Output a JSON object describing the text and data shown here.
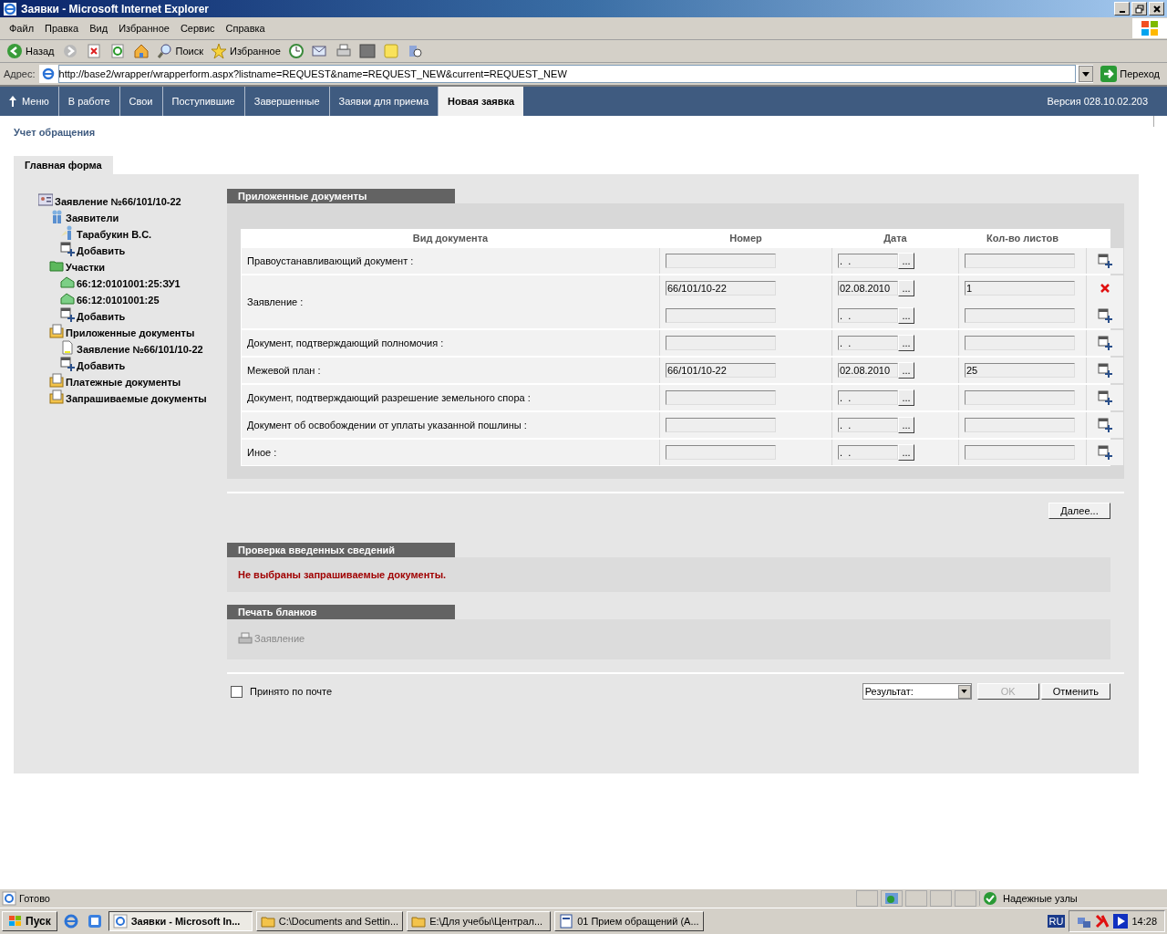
{
  "window": {
    "title": "Заявки - Microsoft Internet Explorer"
  },
  "menu": [
    "Файл",
    "Правка",
    "Вид",
    "Избранное",
    "Сервис",
    "Справка"
  ],
  "toolbar": [
    {
      "kind": "back",
      "label": "Назад"
    },
    {
      "kind": "forward"
    },
    {
      "kind": "stop"
    },
    {
      "kind": "refresh"
    },
    {
      "kind": "home"
    },
    {
      "kind": "search",
      "label": "Поиск"
    },
    {
      "kind": "favorites",
      "label": "Избранное"
    },
    {
      "kind": "history"
    },
    {
      "kind": "mail"
    },
    {
      "kind": "print"
    },
    {
      "kind": "edit"
    },
    {
      "kind": "note"
    },
    {
      "kind": "research"
    }
  ],
  "address": {
    "label": "Адрес:",
    "value": "http://base2/wrapper/wrapperform.aspx?listname=REQUEST&name=REQUEST_NEW&current=REQUEST_NEW",
    "go": "Переход"
  },
  "nav": {
    "tabs": [
      {
        "label": "Меню",
        "selected": false
      },
      {
        "label": "В работе",
        "selected": false
      },
      {
        "label": "Свои",
        "selected": false
      },
      {
        "label": "Поступившие",
        "selected": false
      },
      {
        "label": "Завершенные",
        "selected": false
      },
      {
        "label": "Заявки для приема",
        "selected": false
      },
      {
        "label": "Новая заявка",
        "selected": true
      }
    ],
    "version": "Версия 028.10.02.203"
  },
  "page_title": "Учет обращения",
  "form_tab": "Главная форма",
  "tree": [
    {
      "label": "Заявление №66/101/10-22",
      "kind": "card",
      "children": [
        {
          "label": "Заявители",
          "kind": "people",
          "children": [
            {
              "label": "Тарабукин В.С.",
              "kind": "person"
            },
            {
              "label": "Добавить",
              "kind": "add"
            }
          ]
        },
        {
          "label": "Участки",
          "kind": "folder",
          "children": [
            {
              "label": "66:12:0101001:25:ЗУ1",
              "kind": "parcel"
            },
            {
              "label": "66:12:0101001:25",
              "kind": "parcel"
            },
            {
              "label": "Добавить",
              "kind": "add"
            }
          ]
        },
        {
          "label": "Приложенные документы",
          "kind": "docs",
          "children": [
            {
              "label": "Заявление №66/101/10-22",
              "kind": "doc"
            },
            {
              "label": "Добавить",
              "kind": "add"
            }
          ]
        },
        {
          "label": "Платежные документы",
          "kind": "docs"
        },
        {
          "label": "Запрашиваемые документы",
          "kind": "docs"
        }
      ]
    }
  ],
  "documents": {
    "title": "Приложенные документы",
    "columns": [
      "Вид документа",
      "Номер",
      "Дата",
      "Кол-во листов"
    ],
    "rows": [
      {
        "label": "Правоустанавливающий документ :",
        "entries": [
          {
            "date": ".  .",
            "kind": "add"
          }
        ]
      },
      {
        "label": "Заявление :",
        "entries": [
          {
            "number": "66/101/10-22",
            "date": "02.08.2010",
            "sheets": "1",
            "kind": "delete"
          },
          {
            "date": ".  .",
            "kind": "add"
          }
        ]
      },
      {
        "label": "Документ, подтверждающий полномочия :",
        "entries": [
          {
            "date": ".  .",
            "kind": "add"
          }
        ]
      },
      {
        "label": "Межевой план :",
        "entries": [
          {
            "number": "66/101/10-22",
            "date": "02.08.2010",
            "sheets": "25",
            "kind": "add"
          }
        ]
      },
      {
        "label": "Документ, подтверждающий разрешение земельного спора :",
        "entries": [
          {
            "date": ".  .",
            "kind": "add"
          }
        ]
      },
      {
        "label": "Документ об освобождении от уплаты указанной пошлины :",
        "entries": [
          {
            "date": ".  .",
            "kind": "add"
          }
        ]
      },
      {
        "label": "Иное :",
        "entries": [
          {
            "date": ".  .",
            "kind": "add"
          }
        ]
      }
    ],
    "date_button": "...",
    "next": "Далее..."
  },
  "check": {
    "title": "Проверка введенных сведений",
    "message": "Не выбраны запрашиваемые документы."
  },
  "print": {
    "title": "Печать бланков",
    "link": "Заявление",
    "disabled": true
  },
  "footer": {
    "mail_label": "Принято по почте",
    "mail_checked": false,
    "result": "Результат:",
    "ok": {
      "label": "OK",
      "disabled": true
    },
    "cancel": "Отменить"
  },
  "status_bar": {
    "text": "Готово",
    "zone": "Надежные узлы"
  },
  "taskbar": {
    "start": "Пуск",
    "items": [
      {
        "label": "Заявки - Microsoft In...",
        "kind": "ie",
        "selected": true
      },
      {
        "label": "C:\\Documents and Settin...",
        "kind": "folder",
        "selected": false
      },
      {
        "label": "E:\\Для учебы\\Централ...",
        "kind": "folder",
        "selected": false
      },
      {
        "label": "01 Прием обращений (А...",
        "kind": "word",
        "selected": false
      }
    ],
    "lang": "RU",
    "time": "14:28"
  }
}
